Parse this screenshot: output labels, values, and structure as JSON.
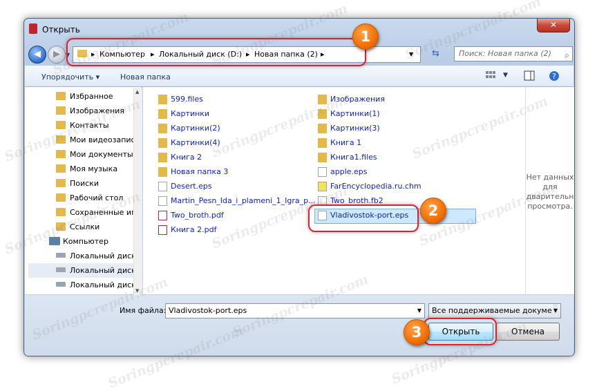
{
  "window": {
    "title": "Открыть",
    "close_label": "✕"
  },
  "address": {
    "crumbs": [
      "Компьютер",
      "Локальный диск (D:)",
      "Новая папка (2)"
    ],
    "separator": "▸"
  },
  "search": {
    "placeholder": "Поиск: Новая папка (2)"
  },
  "toolbar": {
    "organize_label": "Упорядочить",
    "new_folder_label": "Новая папка"
  },
  "nav": {
    "items": [
      "Избранное",
      "Изображения",
      "Контакты",
      "Мои видеозапис",
      "Мои документы",
      "Моя музыка",
      "Поиски",
      "Рабочий стол",
      "Сохраненные иг",
      "Ссылки",
      "Компьютер",
      "Локальный диск",
      "Локальный диск",
      "Локальный диск"
    ]
  },
  "files": {
    "col1": [
      "599.files",
      "Картинки",
      "Картинки(2)",
      "Картинки(4)",
      "Книга 2",
      "Новая папка 3",
      "Desert.eps",
      "Martin_Pesn_Ida_i_plameni_1_Igra_p...",
      "Two_broth.pdf",
      "Книга 2.pdf"
    ],
    "col2": [
      "Изображения",
      "Картинки(1)",
      "Картинки(3)",
      "Книга 1",
      "Книга1.files",
      "apple.eps",
      "FarEncyclopedia.ru.chm",
      "Two_broth.fb2",
      "Vladivostok-port.eps"
    ]
  },
  "preview": {
    "line1": "Нет данных",
    "line2": "для",
    "line3": "дварительн",
    "line4": "просмотра."
  },
  "bottom": {
    "filename_label": "Имя файла:",
    "filename_value": "Vladivostok-port.eps",
    "filetype_value": "Все поддерживаемые докуме",
    "open_label": "Открыть",
    "cancel_label": "Отмена"
  },
  "callouts": {
    "one": "1",
    "two": "2",
    "three": "3"
  },
  "watermark": {
    "text": "Soringpcrepair.com"
  },
  "colors": {
    "accent": "#0c1ec9",
    "callout": "#e0202a",
    "badge": "#f06b00"
  }
}
